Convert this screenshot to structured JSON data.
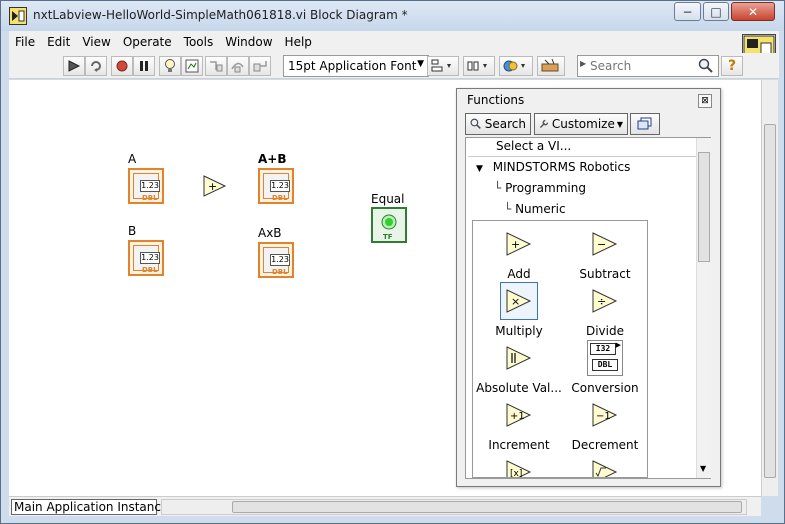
{
  "window": {
    "title": "nxtLabview-HelloWorld-SimpleMath061818.vi Block Diagram *",
    "minimize": "−",
    "maximize": "□",
    "close": "✕"
  },
  "menu": [
    "File",
    "Edit",
    "View",
    "Operate",
    "Tools",
    "Window",
    "Help"
  ],
  "toolbar": {
    "font": "15pt Application Font",
    "search_placeholder": "Search",
    "help": "?"
  },
  "diagram": {
    "nodes": {
      "a_label": "A",
      "b_label": "B",
      "sum_label": "A+B",
      "product_label": "AxB",
      "equal_label": "Equal",
      "numeric_value": "1.23",
      "type": "DBL",
      "bool_type": "TF"
    }
  },
  "status": {
    "instance": "Main Application Instance"
  },
  "palette": {
    "title": "Functions",
    "search_label": "Search",
    "customize_label": "Customize",
    "select_vi": "Select a VI...",
    "tree": [
      "MINDSTORMS Robotics",
      "Programming",
      "Numeric"
    ],
    "functions": [
      {
        "label": "Add",
        "icon": "add-icon"
      },
      {
        "label": "Subtract",
        "icon": "subtract-icon"
      },
      {
        "label": "Multiply",
        "icon": "multiply-icon"
      },
      {
        "label": "Divide",
        "icon": "divide-icon"
      },
      {
        "label": "Absolute Val...",
        "icon": "absolute-value-icon"
      },
      {
        "label": "Conversion",
        "icon": "conversion-icon"
      },
      {
        "label": "Increment",
        "icon": "increment-icon"
      },
      {
        "label": "Decrement",
        "icon": "decrement-icon"
      }
    ],
    "conversion_top": "I32",
    "conversion_bottom": "DBL"
  }
}
